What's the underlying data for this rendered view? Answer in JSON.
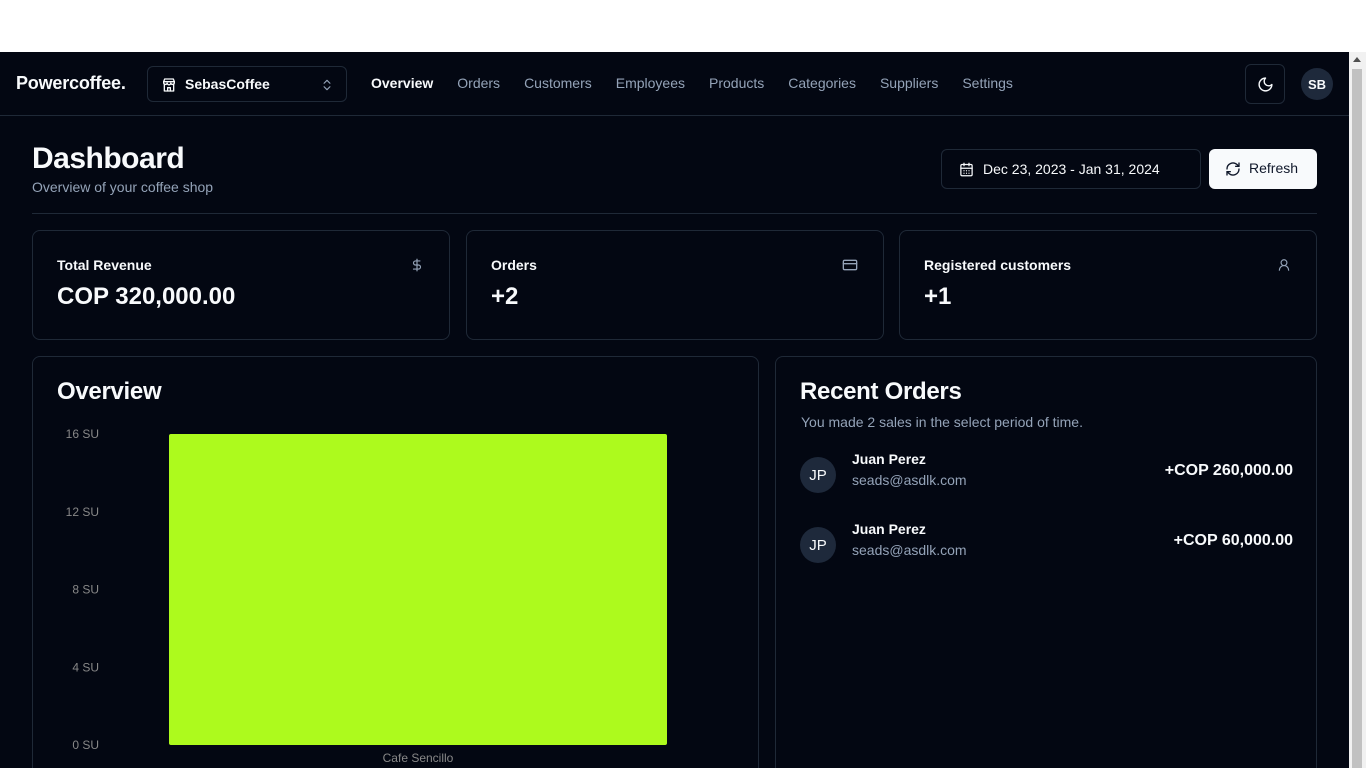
{
  "brand": "Powercoffee.",
  "store_switcher": {
    "name": "SebasCoffee",
    "icon": "store-icon"
  },
  "nav": {
    "items": [
      {
        "label": "Overview",
        "active": true
      },
      {
        "label": "Orders",
        "active": false
      },
      {
        "label": "Customers",
        "active": false
      },
      {
        "label": "Employees",
        "active": false
      },
      {
        "label": "Products",
        "active": false
      },
      {
        "label": "Categories",
        "active": false
      },
      {
        "label": "Suppliers",
        "active": false
      },
      {
        "label": "Settings",
        "active": false
      }
    ]
  },
  "theme_toggle": {
    "icon": "moon-icon"
  },
  "user": {
    "initials": "SB"
  },
  "header": {
    "title": "Dashboard",
    "subtitle": "Overview of your coffee shop",
    "date_range": "Dec 23, 2023 - Jan 31, 2024",
    "refresh_label": "Refresh"
  },
  "stats": [
    {
      "label": "Total Revenue",
      "value": "COP 320,000.00",
      "icon": "dollar-icon"
    },
    {
      "label": "Orders",
      "value": "+2",
      "icon": "credit-card-icon"
    },
    {
      "label": "Registered customers",
      "value": "+1",
      "icon": "user-icon"
    }
  ],
  "overview": {
    "title": "Overview"
  },
  "chart_data": {
    "type": "bar",
    "categories": [
      "Cafe Sencillo"
    ],
    "values": [
      16
    ],
    "ylim": [
      0,
      16
    ],
    "yticks": [
      "0 SU",
      "4 SU",
      "8 SU",
      "12 SU",
      "16 SU"
    ],
    "ytick_values": [
      0,
      4,
      8,
      12,
      16
    ],
    "title": "",
    "xlabel": "",
    "ylabel": "",
    "grid": false,
    "color": "#adfa1d"
  },
  "recent_orders": {
    "title": "Recent Orders",
    "description": "You made 2 sales in the select period of time.",
    "items": [
      {
        "initials": "JP",
        "name": "Juan Perez",
        "email": "seads@asdlk.com",
        "amount": "+COP 260,000.00"
      },
      {
        "initials": "JP",
        "name": "Juan Perez",
        "email": "seads@asdlk.com",
        "amount": "+COP 60,000.00"
      }
    ]
  },
  "colors": {
    "background": "#030712",
    "border": "#1f2937",
    "muted_text": "#94a3b8",
    "text": "#f8fafc",
    "accent_bar": "#adfa1d"
  }
}
